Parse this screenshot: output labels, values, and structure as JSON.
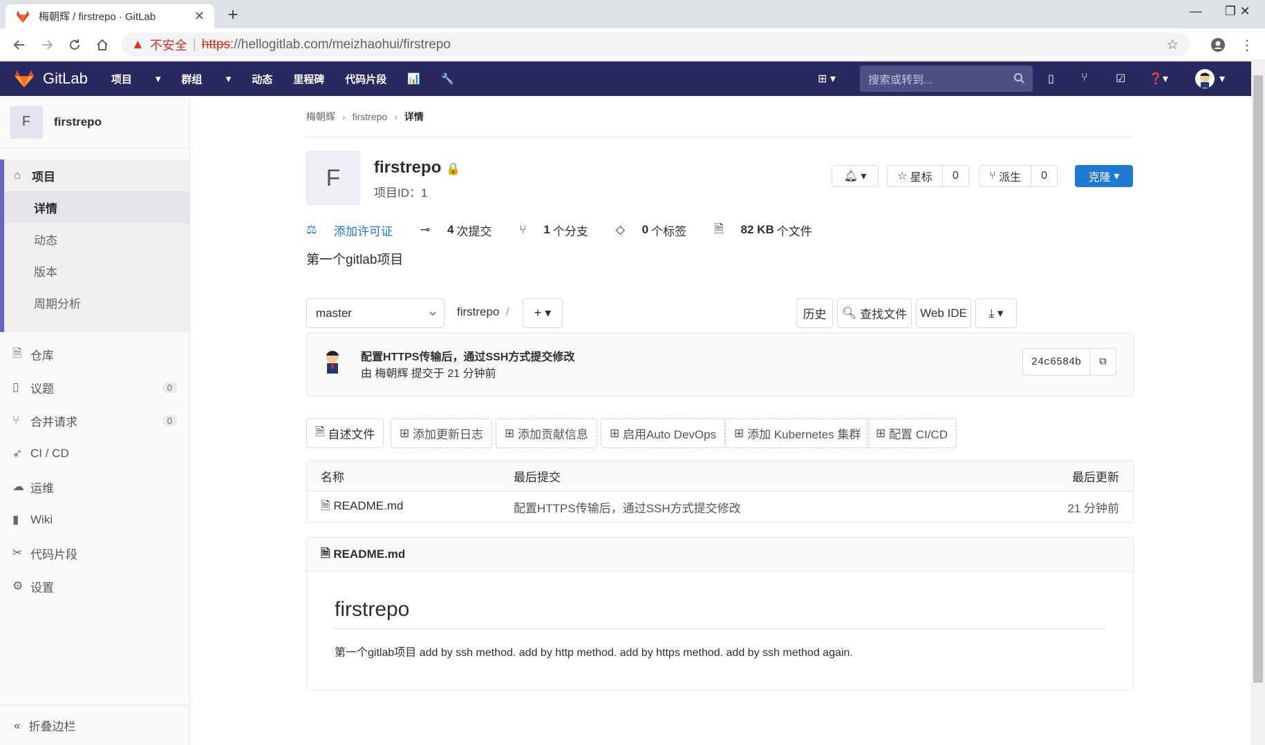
{
  "browser": {
    "tab_title": "梅朝辉 / firstrepo · GitLab",
    "security_label": "不安全",
    "url_scheme": "https",
    "url_rest": "://hellogitlab.com/meizhaohui/firstrepo"
  },
  "gitlab_nav": {
    "logo_text": "GitLab",
    "menu": [
      "项目",
      "群组",
      "动态",
      "里程碑",
      "代码片段"
    ],
    "search_placeholder": "搜索或转到..."
  },
  "sidebar": {
    "project_avatar": "F",
    "project_name": "firstrepo",
    "project_label": "项目",
    "sub_items": [
      "详情",
      "动态",
      "版本",
      "周期分析"
    ],
    "items": [
      {
        "label": "仓库",
        "icon": "doc-icon"
      },
      {
        "label": "议题",
        "icon": "issues-icon",
        "count": "0"
      },
      {
        "label": "合并请求",
        "icon": "merge-request-icon",
        "count": "0"
      },
      {
        "label": "CI / CD",
        "icon": "rocket-icon"
      },
      {
        "label": "运维",
        "icon": "ops-icon"
      },
      {
        "label": "Wiki",
        "icon": "book-icon"
      },
      {
        "label": "代码片段",
        "icon": "scissors-icon"
      },
      {
        "label": "设置",
        "icon": "gear-icon"
      }
    ],
    "collapse_label": "折叠边栏"
  },
  "breadcrumb": [
    "梅朝辉",
    "firstrepo",
    "详情"
  ],
  "project": {
    "avatar": "F",
    "name": "firstrepo",
    "id_text": "项目ID：1",
    "star_label": "星标",
    "star_count": "0",
    "fork_label": "派生",
    "fork_count": "0",
    "clone_label": "克隆",
    "license_link": "添加许可证",
    "commits_num": "4",
    "commits_label": "次提交",
    "branches_num": "1",
    "branches_label": "个分支",
    "tags_num": "0",
    "tags_label": "个标签",
    "size_num": "82 KB",
    "size_label": "个文件",
    "description": "第一个gitlab项目"
  },
  "tree": {
    "branch": "master",
    "path": "firstrepo",
    "path_sep": "/",
    "history": "历史",
    "find_file": "查找文件",
    "web_ide": "Web IDE"
  },
  "last_commit": {
    "message": "配置HTTPS传输后，通过SSH方式提交修改",
    "author_line": "由 梅朝辉 提交于 21 分钟前",
    "sha": "24c6584b"
  },
  "quick_actions": [
    "自述文件",
    "添加更新日志",
    "添加贡献信息",
    "启用Auto DevOps",
    "添加 Kubernetes 集群",
    "配置 CI/CD"
  ],
  "files": {
    "headers": [
      "名称",
      "最后提交",
      "最后更新"
    ],
    "rows": [
      {
        "name": "README.md",
        "commit": "配置HTTPS传输后，通过SSH方式提交修改",
        "updated": "21 分钟前"
      }
    ]
  },
  "readme": {
    "filename": "README.md",
    "heading": "firstrepo",
    "body": "第一个gitlab项目 add by ssh method. add by http method. add by https method. add by ssh method again."
  }
}
